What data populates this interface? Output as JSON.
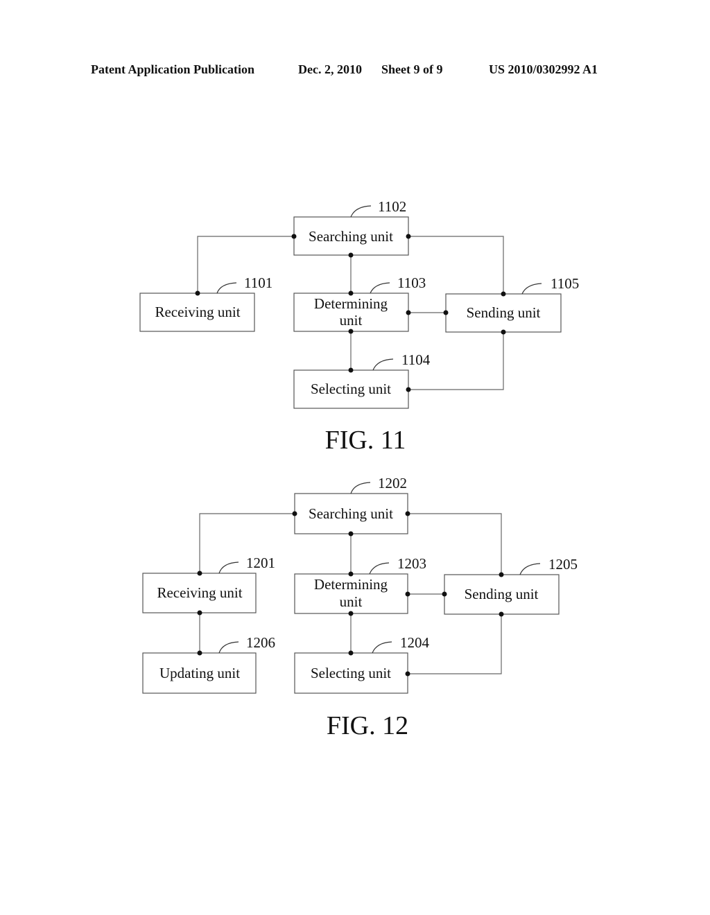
{
  "header": {
    "left": "Patent Application Publication",
    "date": "Dec. 2, 2010",
    "sheet": "Sheet 9 of 9",
    "number": "US 2010/0302992 A1"
  },
  "figures": [
    {
      "caption": "FIG. 11",
      "units": [
        {
          "id": "searching",
          "ref": "1102",
          "label": [
            "Searching unit"
          ]
        },
        {
          "id": "receiving",
          "ref": "1101",
          "label": [
            "Receiving unit"
          ]
        },
        {
          "id": "determining",
          "ref": "1103",
          "label": [
            "Determining",
            "unit"
          ]
        },
        {
          "id": "sending",
          "ref": "1105",
          "label": [
            "Sending unit"
          ]
        },
        {
          "id": "selecting",
          "ref": "1104",
          "label": [
            "Selecting unit"
          ]
        }
      ],
      "connections": [
        [
          "searching",
          "receiving"
        ],
        [
          "searching",
          "determining"
        ],
        [
          "searching",
          "sending"
        ],
        [
          "determining",
          "sending"
        ],
        [
          "determining",
          "selecting"
        ],
        [
          "sending",
          "selecting"
        ]
      ]
    },
    {
      "caption": "FIG. 12",
      "units": [
        {
          "id": "searching",
          "ref": "1202",
          "label": [
            "Searching unit"
          ]
        },
        {
          "id": "receiving",
          "ref": "1201",
          "label": [
            "Receiving unit"
          ]
        },
        {
          "id": "determining",
          "ref": "1203",
          "label": [
            "Determining",
            "unit"
          ]
        },
        {
          "id": "sending",
          "ref": "1205",
          "label": [
            "Sending unit"
          ]
        },
        {
          "id": "selecting",
          "ref": "1204",
          "label": [
            "Selecting unit"
          ]
        },
        {
          "id": "updating",
          "ref": "1206",
          "label": [
            "Updating unit"
          ]
        }
      ],
      "connections": [
        [
          "searching",
          "receiving"
        ],
        [
          "searching",
          "determining"
        ],
        [
          "searching",
          "sending"
        ],
        [
          "determining",
          "sending"
        ],
        [
          "determining",
          "selecting"
        ],
        [
          "sending",
          "selecting"
        ],
        [
          "receiving",
          "updating"
        ]
      ]
    }
  ]
}
